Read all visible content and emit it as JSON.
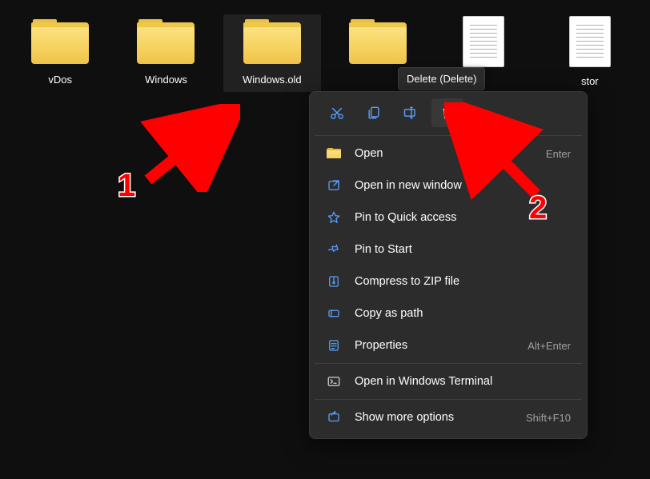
{
  "desktop_items": [
    {
      "label": "vDos",
      "type": "folder",
      "selected": false
    },
    {
      "label": "Windows",
      "type": "folder",
      "selected": false
    },
    {
      "label": "Windows.old",
      "type": "folder",
      "selected": true
    },
    {
      "label": "",
      "type": "folder",
      "selected": false
    },
    {
      "label": "",
      "type": "file",
      "selected": false
    },
    {
      "label": "stor",
      "type": "file",
      "selected": false
    }
  ],
  "tooltip": "Delete (Delete)",
  "quick_actions": [
    "cut",
    "copy",
    "rename",
    "delete"
  ],
  "context_menu": {
    "sections": [
      [
        {
          "icon": "folder",
          "label": "Open",
          "shortcut": "Enter"
        },
        {
          "icon": "new-window",
          "label": "Open in new window",
          "shortcut": ""
        },
        {
          "icon": "star",
          "label": "Pin to Quick access",
          "shortcut": ""
        },
        {
          "icon": "pin",
          "label": "Pin to Start",
          "shortcut": ""
        },
        {
          "icon": "zip",
          "label": "Compress to ZIP file",
          "shortcut": ""
        },
        {
          "icon": "copy-path",
          "label": "Copy as path",
          "shortcut": ""
        },
        {
          "icon": "properties",
          "label": "Properties",
          "shortcut": "Alt+Enter"
        }
      ],
      [
        {
          "icon": "terminal",
          "label": "Open in Windows Terminal",
          "shortcut": ""
        }
      ],
      [
        {
          "icon": "more",
          "label": "Show more options",
          "shortcut": "Shift+F10"
        }
      ]
    ]
  },
  "annotations": {
    "first": "1",
    "second": "2"
  }
}
